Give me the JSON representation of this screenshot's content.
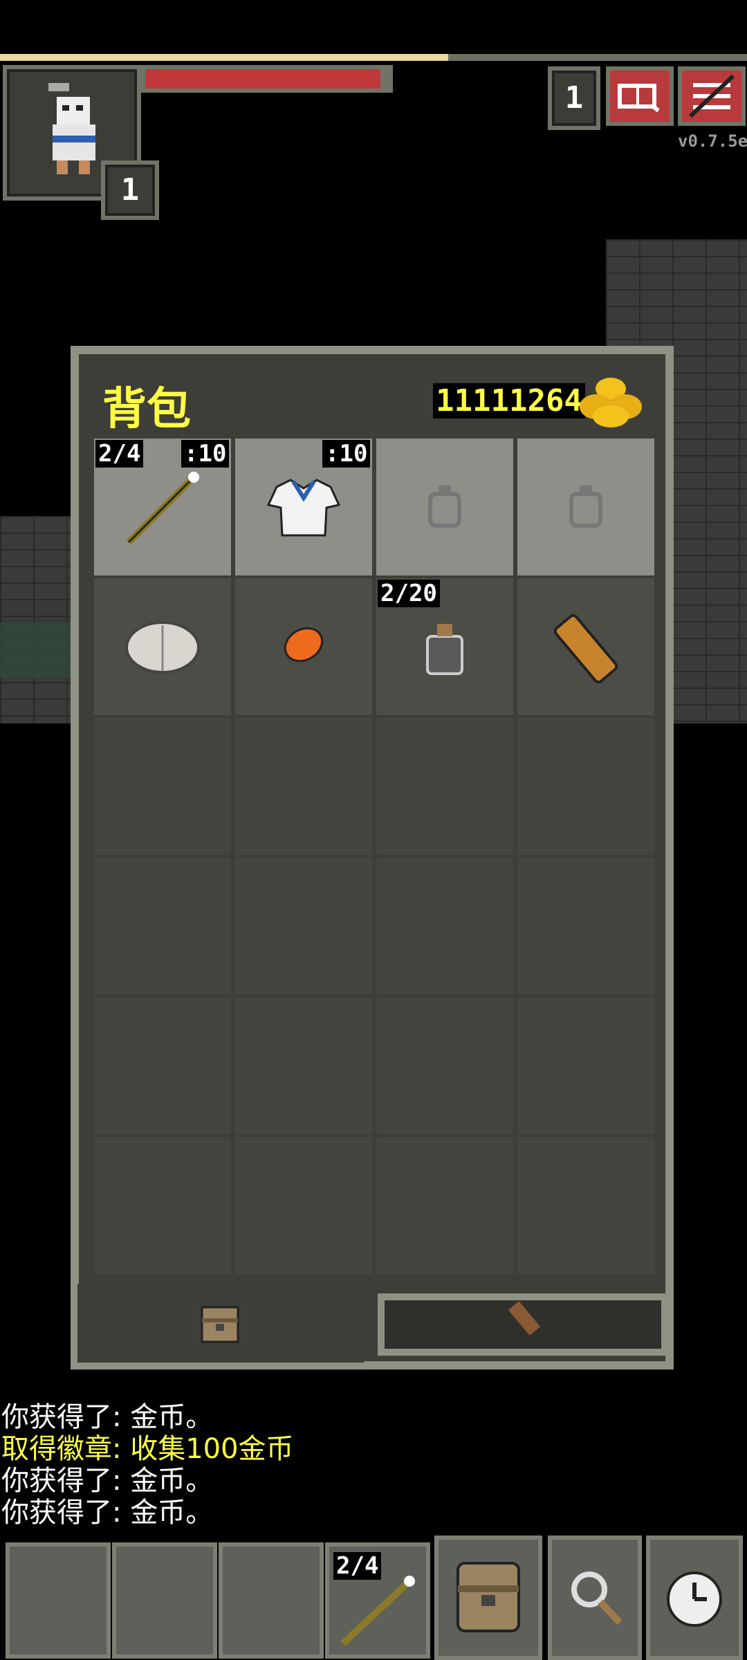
{
  "status": {
    "hero_level": "1",
    "depth": "1",
    "version": "v0.7.5e"
  },
  "backpack": {
    "title": "背包",
    "gold": "11111264",
    "slots": {
      "weapon_charges": "2/4",
      "weapon_level": ":10",
      "armor_level": ":10",
      "waterskin": "2/20"
    }
  },
  "log": {
    "messages": [
      {
        "text": "你获得了: 金币。",
        "color": "#ffffff"
      },
      {
        "text": "取得徽章: 收集100金币",
        "color": "#ffff44"
      },
      {
        "text": "你获得了: 金币。",
        "color": "#ffffff"
      },
      {
        "text": "你获得了: 金币。",
        "color": "#ffffff"
      }
    ]
  },
  "quickbar": {
    "wand_charges": "2/4"
  },
  "colors": {
    "gold_text": "#ffff44",
    "health": "#c0383a",
    "danger_button": "#b83a3c"
  }
}
